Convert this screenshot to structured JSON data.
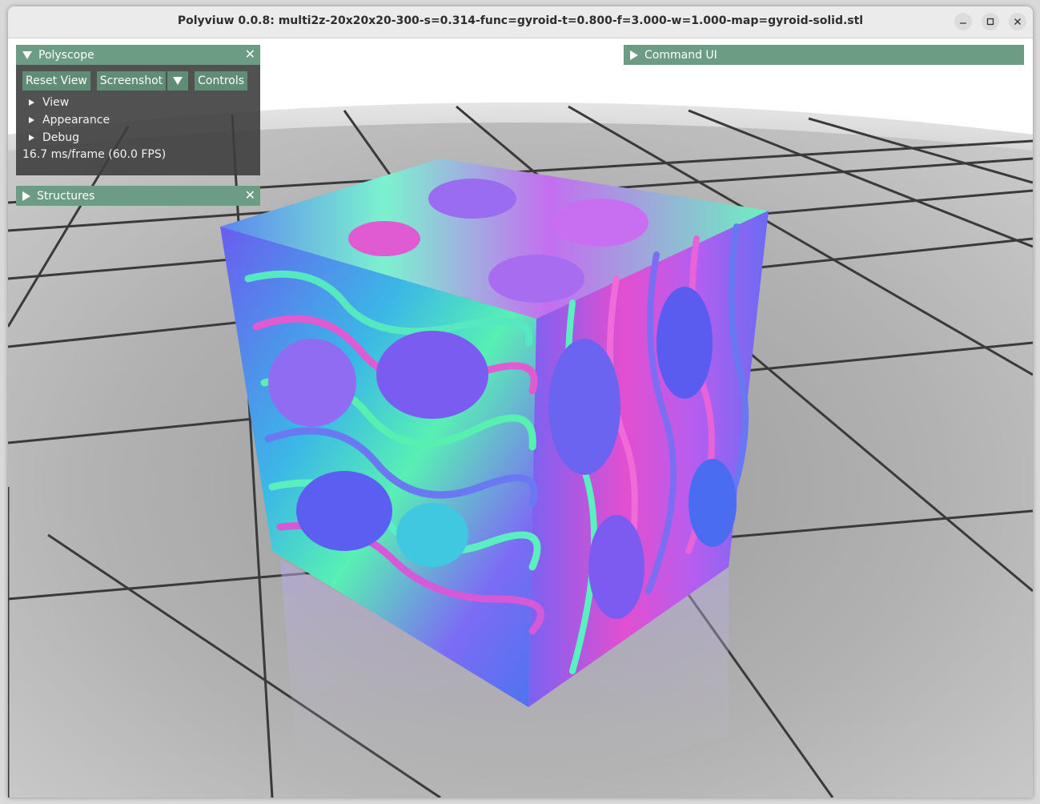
{
  "window": {
    "title": "Polyviuw 0.0.8: multi2z-20x20x20-300-s=0.314-func=gyroid-t=0.800-f=3.000-w=1.000-map=gyroid-solid.stl",
    "minimize_icon": "minimize-icon",
    "maximize_icon": "maximize-icon",
    "close_icon": "close-icon"
  },
  "polyscope_panel": {
    "title": "Polyscope",
    "close_glyph": "✕",
    "buttons": {
      "reset_view": "Reset View",
      "screenshot": "Screenshot",
      "controls": "Controls"
    },
    "tree": [
      "View",
      "Appearance",
      "Debug"
    ],
    "fps": "16.7 ms/frame (60.0 FPS)"
  },
  "structures_panel": {
    "title": "Structures",
    "close_glyph": "✕"
  },
  "command_panel": {
    "title": "Command UI"
  },
  "colors": {
    "panel_header": "#6c9c84",
    "panel_body": "#3e3e3e",
    "button": "#5f8d76",
    "titlebar": "#ebebeb"
  }
}
